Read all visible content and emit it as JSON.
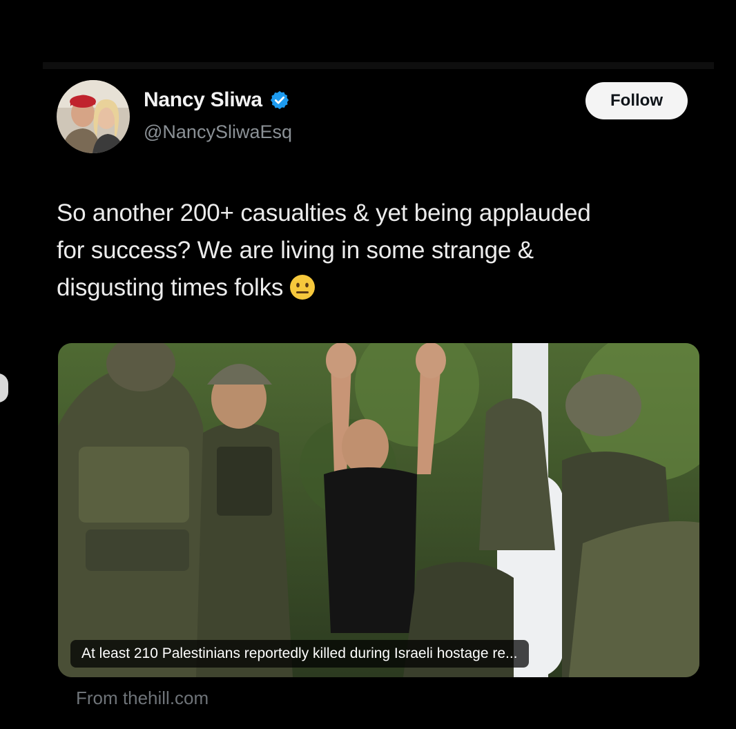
{
  "colors": {
    "background": "#000000",
    "text_primary": "#e7e9ea",
    "text_secondary": "#8b9196",
    "verified": "#1d9bf0",
    "follow_bg": "#f4f4f4"
  },
  "tweet": {
    "author": {
      "display_name": "Nancy Sliwa",
      "handle": "@NancySliwaEsq",
      "verified_icon": "verified-badge-icon",
      "avatar_icon": "profile-photo"
    },
    "follow_label": "Follow",
    "text_lines": [
      "So another 200+ casualties & yet being applauded",
      "for success?  We are living in some strange &",
      "disgusting times folks"
    ],
    "emoji": "neutral-face-emoji",
    "media": {
      "caption": "At least 210 Palestinians reportedly killed during Israeli hostage re...",
      "source": "From thehill.com"
    }
  }
}
